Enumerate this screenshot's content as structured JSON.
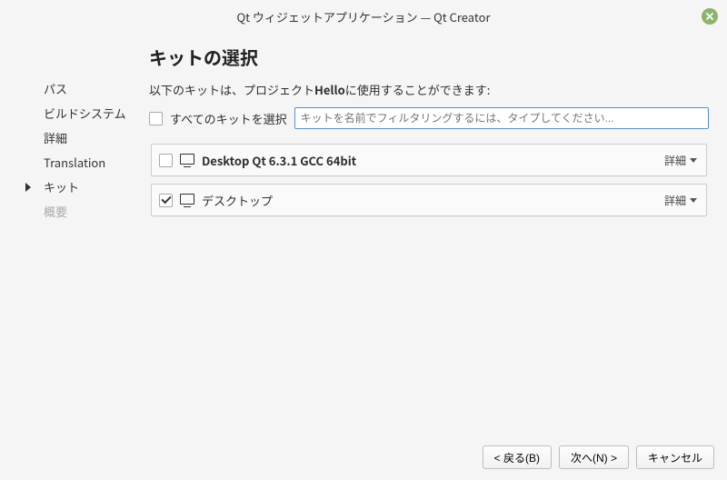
{
  "titlebar": {
    "title": "Qt ウィジェットアプリケーション — Qt Creator"
  },
  "sidebar": {
    "steps": [
      {
        "label": "パス"
      },
      {
        "label": "ビルドシステム"
      },
      {
        "label": "詳細"
      },
      {
        "label": "Translation"
      },
      {
        "label": "キット"
      },
      {
        "label": "概要"
      }
    ]
  },
  "main": {
    "title": "キットの選択",
    "subtitle_pre": "以下のキットは、プロジェクト",
    "project_name": "Hello",
    "subtitle_post": "に使用することができます:",
    "select_all_label": "すべてのキットを選択",
    "filter_placeholder": "キットを名前でフィルタリングするには、タイプしてください...",
    "kits": [
      {
        "name": "Desktop Qt 6.3.1 GCC 64bit",
        "checked": false,
        "bold": true,
        "detail_label": "詳細"
      },
      {
        "name": "デスクトップ",
        "checked": true,
        "bold": false,
        "detail_label": "詳細"
      }
    ]
  },
  "buttons": {
    "back": "< 戻る(B)",
    "next": "次へ(N) >",
    "cancel": "キャンセル"
  }
}
